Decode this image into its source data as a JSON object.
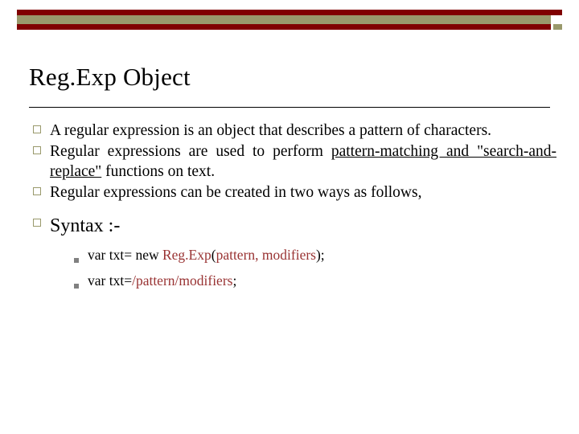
{
  "slide": {
    "title": "Reg.Exp Object",
    "banner": {
      "accent_color": "#800000",
      "olive_color": "#99996b"
    },
    "bullets": [
      {
        "marker": "hollow-square",
        "segments": [
          {
            "text": "A regular expression is an object that describes a pattern of characters.",
            "style": "plain"
          }
        ]
      },
      {
        "marker": "hollow-square",
        "segments": [
          {
            "text": "Regular expressions are used to perform ",
            "style": "plain"
          },
          {
            "text": "pattern-matching and \"search-and-replace\"",
            "style": "underline"
          },
          {
            "text": " functions on text.",
            "style": "plain"
          }
        ]
      },
      {
        "marker": "hollow-square",
        "segments": [
          {
            "text": "Regular expressions can be created in two ways as follows,",
            "style": "plain"
          }
        ]
      }
    ],
    "syntax": {
      "marker": "hollow-square",
      "label": "Syntax :-",
      "items": [
        {
          "marker": "filled-square",
          "segments": [
            {
              "text": "var txt= new ",
              "style": "plain"
            },
            {
              "text": "Reg.Exp",
              "style": "red"
            },
            {
              "text": "(",
              "style": "plain"
            },
            {
              "text": "pattern, modifiers",
              "style": "red"
            },
            {
              "text": ");",
              "style": "plain"
            }
          ]
        },
        {
          "marker": "filled-square",
          "segments": [
            {
              "text": "var txt=",
              "style": "plain"
            },
            {
              "text": "/pattern/modifiers",
              "style": "red"
            },
            {
              "text": ";",
              "style": "plain"
            }
          ]
        }
      ]
    }
  }
}
